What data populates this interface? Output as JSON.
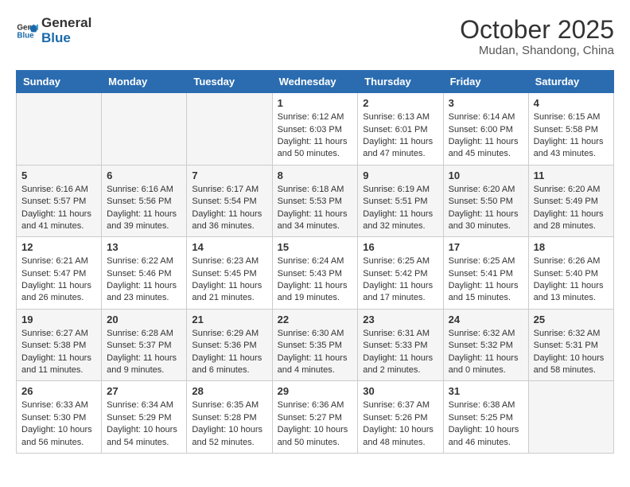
{
  "header": {
    "logo_general": "General",
    "logo_blue": "Blue",
    "month_title": "October 2025",
    "subtitle": "Mudan, Shandong, China"
  },
  "days_of_week": [
    "Sunday",
    "Monday",
    "Tuesday",
    "Wednesday",
    "Thursday",
    "Friday",
    "Saturday"
  ],
  "weeks": [
    [
      {
        "day": "",
        "info": ""
      },
      {
        "day": "",
        "info": ""
      },
      {
        "day": "",
        "info": ""
      },
      {
        "day": "1",
        "info": "Sunrise: 6:12 AM\nSunset: 6:03 PM\nDaylight: 11 hours and 50 minutes."
      },
      {
        "day": "2",
        "info": "Sunrise: 6:13 AM\nSunset: 6:01 PM\nDaylight: 11 hours and 47 minutes."
      },
      {
        "day": "3",
        "info": "Sunrise: 6:14 AM\nSunset: 6:00 PM\nDaylight: 11 hours and 45 minutes."
      },
      {
        "day": "4",
        "info": "Sunrise: 6:15 AM\nSunset: 5:58 PM\nDaylight: 11 hours and 43 minutes."
      }
    ],
    [
      {
        "day": "5",
        "info": "Sunrise: 6:16 AM\nSunset: 5:57 PM\nDaylight: 11 hours and 41 minutes."
      },
      {
        "day": "6",
        "info": "Sunrise: 6:16 AM\nSunset: 5:56 PM\nDaylight: 11 hours and 39 minutes."
      },
      {
        "day": "7",
        "info": "Sunrise: 6:17 AM\nSunset: 5:54 PM\nDaylight: 11 hours and 36 minutes."
      },
      {
        "day": "8",
        "info": "Sunrise: 6:18 AM\nSunset: 5:53 PM\nDaylight: 11 hours and 34 minutes."
      },
      {
        "day": "9",
        "info": "Sunrise: 6:19 AM\nSunset: 5:51 PM\nDaylight: 11 hours and 32 minutes."
      },
      {
        "day": "10",
        "info": "Sunrise: 6:20 AM\nSunset: 5:50 PM\nDaylight: 11 hours and 30 minutes."
      },
      {
        "day": "11",
        "info": "Sunrise: 6:20 AM\nSunset: 5:49 PM\nDaylight: 11 hours and 28 minutes."
      }
    ],
    [
      {
        "day": "12",
        "info": "Sunrise: 6:21 AM\nSunset: 5:47 PM\nDaylight: 11 hours and 26 minutes."
      },
      {
        "day": "13",
        "info": "Sunrise: 6:22 AM\nSunset: 5:46 PM\nDaylight: 11 hours and 23 minutes."
      },
      {
        "day": "14",
        "info": "Sunrise: 6:23 AM\nSunset: 5:45 PM\nDaylight: 11 hours and 21 minutes."
      },
      {
        "day": "15",
        "info": "Sunrise: 6:24 AM\nSunset: 5:43 PM\nDaylight: 11 hours and 19 minutes."
      },
      {
        "day": "16",
        "info": "Sunrise: 6:25 AM\nSunset: 5:42 PM\nDaylight: 11 hours and 17 minutes."
      },
      {
        "day": "17",
        "info": "Sunrise: 6:25 AM\nSunset: 5:41 PM\nDaylight: 11 hours and 15 minutes."
      },
      {
        "day": "18",
        "info": "Sunrise: 6:26 AM\nSunset: 5:40 PM\nDaylight: 11 hours and 13 minutes."
      }
    ],
    [
      {
        "day": "19",
        "info": "Sunrise: 6:27 AM\nSunset: 5:38 PM\nDaylight: 11 hours and 11 minutes."
      },
      {
        "day": "20",
        "info": "Sunrise: 6:28 AM\nSunset: 5:37 PM\nDaylight: 11 hours and 9 minutes."
      },
      {
        "day": "21",
        "info": "Sunrise: 6:29 AM\nSunset: 5:36 PM\nDaylight: 11 hours and 6 minutes."
      },
      {
        "day": "22",
        "info": "Sunrise: 6:30 AM\nSunset: 5:35 PM\nDaylight: 11 hours and 4 minutes."
      },
      {
        "day": "23",
        "info": "Sunrise: 6:31 AM\nSunset: 5:33 PM\nDaylight: 11 hours and 2 minutes."
      },
      {
        "day": "24",
        "info": "Sunrise: 6:32 AM\nSunset: 5:32 PM\nDaylight: 11 hours and 0 minutes."
      },
      {
        "day": "25",
        "info": "Sunrise: 6:32 AM\nSunset: 5:31 PM\nDaylight: 10 hours and 58 minutes."
      }
    ],
    [
      {
        "day": "26",
        "info": "Sunrise: 6:33 AM\nSunset: 5:30 PM\nDaylight: 10 hours and 56 minutes."
      },
      {
        "day": "27",
        "info": "Sunrise: 6:34 AM\nSunset: 5:29 PM\nDaylight: 10 hours and 54 minutes."
      },
      {
        "day": "28",
        "info": "Sunrise: 6:35 AM\nSunset: 5:28 PM\nDaylight: 10 hours and 52 minutes."
      },
      {
        "day": "29",
        "info": "Sunrise: 6:36 AM\nSunset: 5:27 PM\nDaylight: 10 hours and 50 minutes."
      },
      {
        "day": "30",
        "info": "Sunrise: 6:37 AM\nSunset: 5:26 PM\nDaylight: 10 hours and 48 minutes."
      },
      {
        "day": "31",
        "info": "Sunrise: 6:38 AM\nSunset: 5:25 PM\nDaylight: 10 hours and 46 minutes."
      },
      {
        "day": "",
        "info": ""
      }
    ]
  ]
}
